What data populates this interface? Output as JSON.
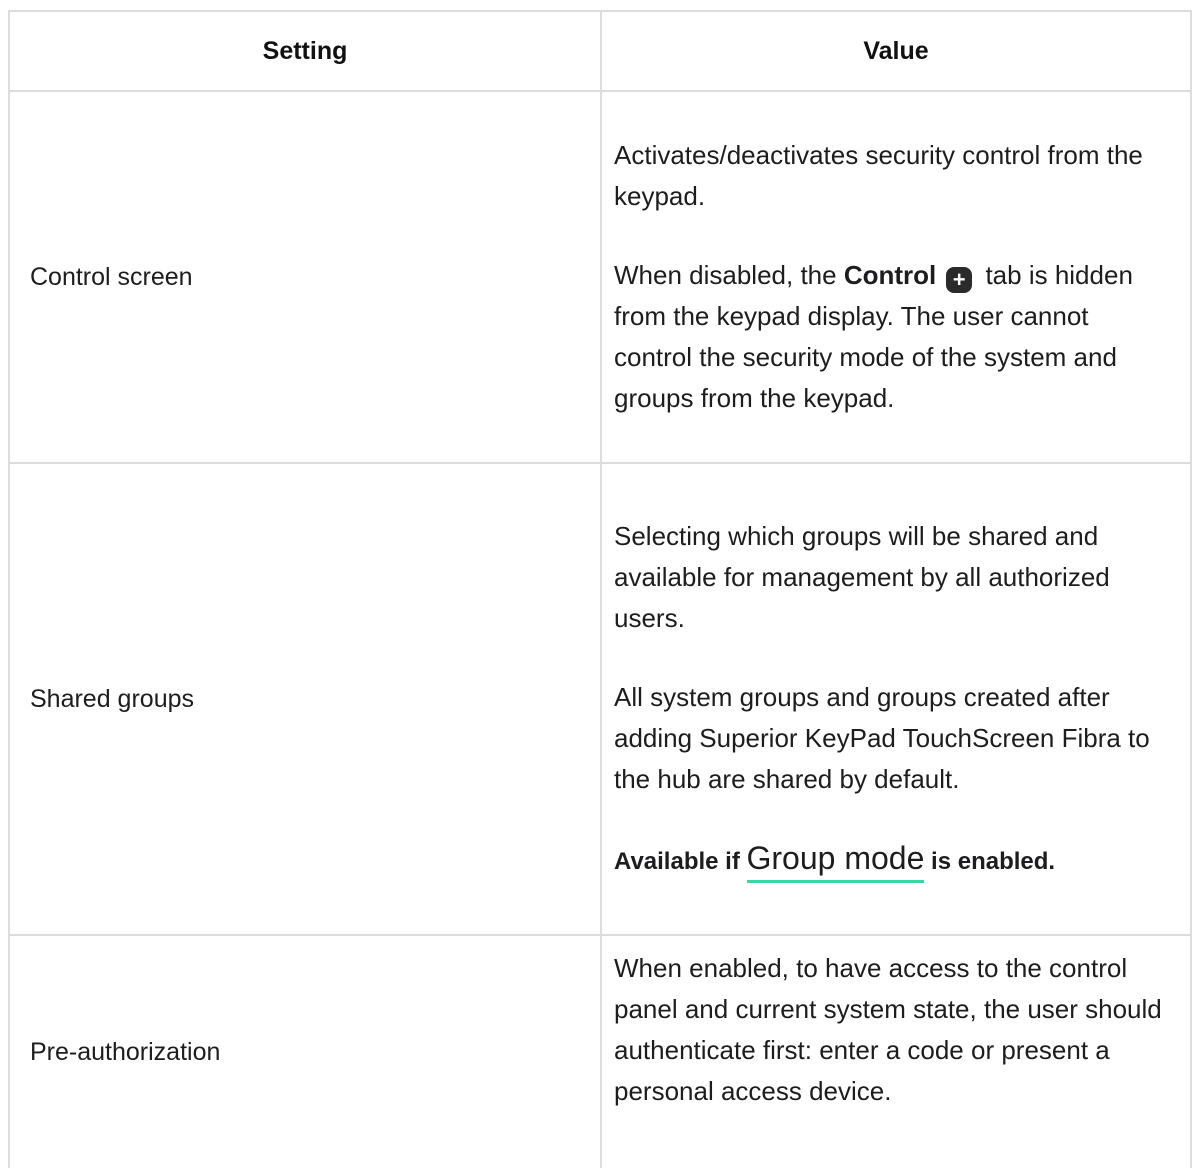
{
  "table": {
    "headers": {
      "setting": "Setting",
      "value": "Value"
    },
    "rows": [
      {
        "setting": "Control screen",
        "p1": "Activates/deactivates security control from the keypad.",
        "p2_before": "When disabled, the ",
        "p2_bold": "Control",
        "p2_icon": "plus-icon",
        "p2_after": " tab is hidden from the keypad display. The user cannot control the security mode of the system and groups from the keypad."
      },
      {
        "setting": "Shared groups",
        "p1": "Selecting which groups will be shared and available for management by all authorized users.",
        "p2": "All system groups and groups created after adding Superior KeyPad TouchScreen Fibra to the hub are shared by default.",
        "note_before": "Available if ",
        "note_link": "Group mode",
        "note_after": " is enabled."
      },
      {
        "setting": "Pre-authorization",
        "p1": "When enabled, to have access to the control panel and current system state, the user should authenticate first: enter a code or present a personal access device."
      }
    ]
  },
  "colors": {
    "border": "#dddddd",
    "text": "#1d1d1f",
    "link_underline": "#3ed6a0",
    "icon_bg": "#2b2b2b"
  }
}
